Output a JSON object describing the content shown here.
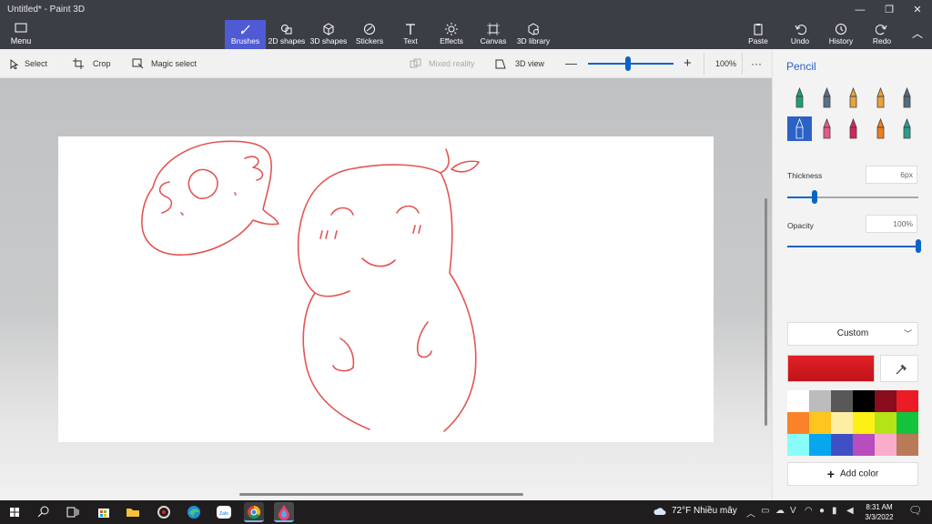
{
  "window": {
    "title": "Untitled* - Paint 3D",
    "controls": [
      "minimize",
      "restore",
      "close"
    ]
  },
  "toolbar": {
    "menu_label": "Menu",
    "tools": [
      {
        "label": "Brushes",
        "icon": "brush-icon",
        "active": true
      },
      {
        "label": "2D shapes",
        "icon": "2d-shapes-icon"
      },
      {
        "label": "3D shapes",
        "icon": "3d-shapes-icon"
      },
      {
        "label": "Stickers",
        "icon": "sticker-icon"
      },
      {
        "label": "Text",
        "icon": "text-icon"
      },
      {
        "label": "Effects",
        "icon": "effects-icon"
      },
      {
        "label": "Canvas",
        "icon": "canvas-icon"
      },
      {
        "label": "3D library",
        "icon": "3d-library-icon"
      }
    ],
    "right_tools": [
      {
        "label": "Paste",
        "icon": "paste-icon"
      },
      {
        "label": "Undo",
        "icon": "undo-icon"
      },
      {
        "label": "History",
        "icon": "history-icon"
      },
      {
        "label": "Redo",
        "icon": "redo-icon"
      }
    ]
  },
  "subbar": {
    "select": "Select",
    "crop": "Crop",
    "magic_select": "Magic select",
    "mixed_reality": "Mixed reality",
    "view_3d": "3D view",
    "zoom": "100%",
    "zoom_level": 0.47,
    "more": "···"
  },
  "panel": {
    "title": "Pencil",
    "brushes": [
      {
        "name": "marker",
        "color": "#1f9d7a"
      },
      {
        "name": "calligraphy-pen",
        "color": "#5b6f85"
      },
      {
        "name": "oil-brush",
        "color": "#e9a23b"
      },
      {
        "name": "watercolor",
        "color": "#e9a23b"
      },
      {
        "name": "pixel-pen",
        "color": "#566a7d"
      },
      {
        "name": "pencil",
        "color": "#2b62c6",
        "selected": true
      },
      {
        "name": "eraser",
        "color": "#e65a8a"
      },
      {
        "name": "crayon",
        "color": "#d6245a"
      },
      {
        "name": "spray-can",
        "color": "#f07d20"
      },
      {
        "name": "fill",
        "color": "#2a9d8f"
      }
    ],
    "thickness_label": "Thickness",
    "thickness_value": "6px",
    "thickness_level": 0.21,
    "opacity_label": "Opacity",
    "opacity_value": "100%",
    "opacity_level": 1.0,
    "color_mode": "Custom",
    "current_color": "#e41f26",
    "swatches": [
      "#ffffff",
      "#bcbcbc",
      "#585858",
      "#000000",
      "#8a0c1f",
      "#ec1c24",
      "#fa8228",
      "#fec51f",
      "#fdeea3",
      "#fdf014",
      "#b4e318",
      "#14c33c",
      "#89fdfa",
      "#07a7f0",
      "#404fc4",
      "#b84dbd",
      "#f9adca",
      "#b97a57"
    ],
    "add_color": "Add color"
  },
  "taskbar": {
    "apps": [
      "start-icon",
      "search-icon",
      "task-view-icon",
      "store-icon",
      "file-explorer-icon",
      "media-icon",
      "edge-icon",
      "zalo-icon",
      "chrome-icon",
      "paint3d-icon"
    ],
    "weather": "72°F Nhiều mây",
    "time": "8:31 AM",
    "date": "3/3/2022"
  }
}
